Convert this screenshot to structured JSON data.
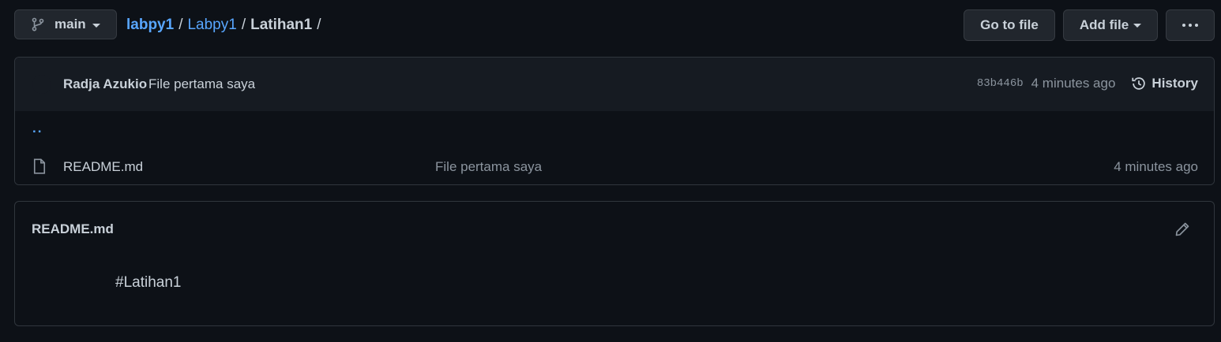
{
  "toolbar": {
    "branch": "main",
    "breadcrumb": {
      "owner": "labpy1",
      "repo": "Labpy1",
      "current": "Latihan1",
      "separator": "/"
    },
    "go_to_file": "Go to file",
    "add_file": "Add file"
  },
  "commit": {
    "author": "Radja Azukio",
    "message": "File pertama saya",
    "sha": "83b446b",
    "time": "4 minutes ago",
    "history_label": "History"
  },
  "parent_dir": "..",
  "files": [
    {
      "name": "README.md",
      "commit_message": "File pertama saya",
      "time": "4 minutes ago",
      "icon": "file-icon"
    }
  ],
  "readme": {
    "title": "README.md",
    "content": "#Latihan1"
  },
  "colors": {
    "background": "#0d1117",
    "panel": "#161b22",
    "border": "#30363d",
    "link": "#58a6ff",
    "text": "#c9d1d9",
    "muted": "#8b949e"
  }
}
